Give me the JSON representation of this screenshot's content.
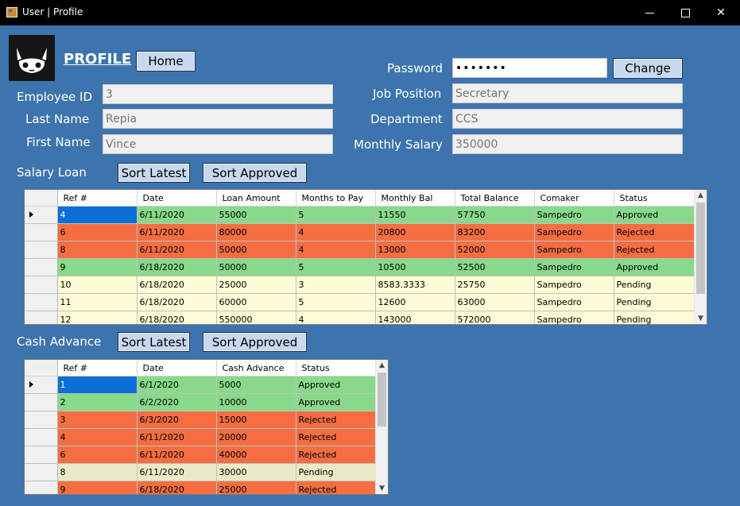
{
  "window": {
    "title": "User | Profile"
  },
  "header": {
    "title": "PROFILE",
    "home_label": "Home"
  },
  "form": {
    "employee_id_label": "Employee ID",
    "employee_id": "3",
    "last_name_label": "Last Name",
    "last_name": "Repia",
    "first_name_label": "First Name",
    "first_name": "Vince",
    "password_label": "Password",
    "password": "•••••••",
    "change_label": "Change",
    "job_position_label": "Job Position",
    "job_position": "Secretary",
    "department_label": "Department",
    "department": "CCS",
    "monthly_salary_label": "Monthly Salary",
    "monthly_salary": "350000"
  },
  "salary_loan": {
    "title": "Salary Loan",
    "sort_latest_label": "Sort Latest",
    "sort_approved_label": "Sort Approved",
    "columns": [
      "Ref #",
      "Date",
      "Loan Amount",
      "Months to Pay",
      "Monthly Bal",
      "Total Balance",
      "Comaker",
      "Status"
    ],
    "rows": [
      {
        "status": "approved",
        "cells": [
          "4",
          "6/11/2020",
          "55000",
          "5",
          "11550",
          "57750",
          "Sampedro",
          "Approved"
        ]
      },
      {
        "status": "rejected",
        "cells": [
          "6",
          "6/11/2020",
          "80000",
          "4",
          "20800",
          "83200",
          "Sampedro",
          "Rejected"
        ]
      },
      {
        "status": "rejected",
        "cells": [
          "8",
          "6/11/2020",
          "50000",
          "4",
          "13000",
          "52000",
          "Sampedro",
          "Rejected"
        ]
      },
      {
        "status": "approved",
        "cells": [
          "9",
          "6/18/2020",
          "50000",
          "5",
          "10500",
          "52500",
          "Sampedro",
          "Approved"
        ]
      },
      {
        "status": "pending1",
        "cells": [
          "10",
          "6/18/2020",
          "25000",
          "3",
          "8583.3333",
          "25750",
          "Sampedro",
          "Pending"
        ]
      },
      {
        "status": "pending1",
        "cells": [
          "11",
          "6/18/2020",
          "60000",
          "5",
          "12600",
          "63000",
          "Sampedro",
          "Pending"
        ]
      },
      {
        "status": "pending1",
        "cells": [
          "12",
          "6/18/2020",
          "550000",
          "4",
          "143000",
          "572000",
          "Sampedro",
          "Pending"
        ]
      }
    ]
  },
  "cash_advance": {
    "title": "Cash Advance",
    "sort_latest_label": "Sort Latest",
    "sort_approved_label": "Sort Approved",
    "columns": [
      "Ref #",
      "Date",
      "Cash Advance",
      "Status"
    ],
    "rows": [
      {
        "status": "approved",
        "cells": [
          "1",
          "6/1/2020",
          "5000",
          "Approved"
        ]
      },
      {
        "status": "approved",
        "cells": [
          "2",
          "6/2/2020",
          "10000",
          "Approved"
        ]
      },
      {
        "status": "rejected",
        "cells": [
          "3",
          "6/3/2020",
          "15000",
          "Rejected"
        ]
      },
      {
        "status": "rejected",
        "cells": [
          "4",
          "6/11/2020",
          "20000",
          "Rejected"
        ]
      },
      {
        "status": "rejected",
        "cells": [
          "6",
          "6/11/2020",
          "40000",
          "Rejected"
        ]
      },
      {
        "status": "pending2",
        "cells": [
          "8",
          "6/11/2020",
          "30000",
          "Pending"
        ]
      },
      {
        "status": "rejected",
        "cells": [
          "9",
          "6/18/2020",
          "25000",
          "Rejected"
        ]
      }
    ]
  },
  "colors": {
    "background": "#3d74ad",
    "approved": "#88d98a",
    "rejected": "#f46e42",
    "pending": "#fdfbd5",
    "selected": "#0a6fd6"
  }
}
